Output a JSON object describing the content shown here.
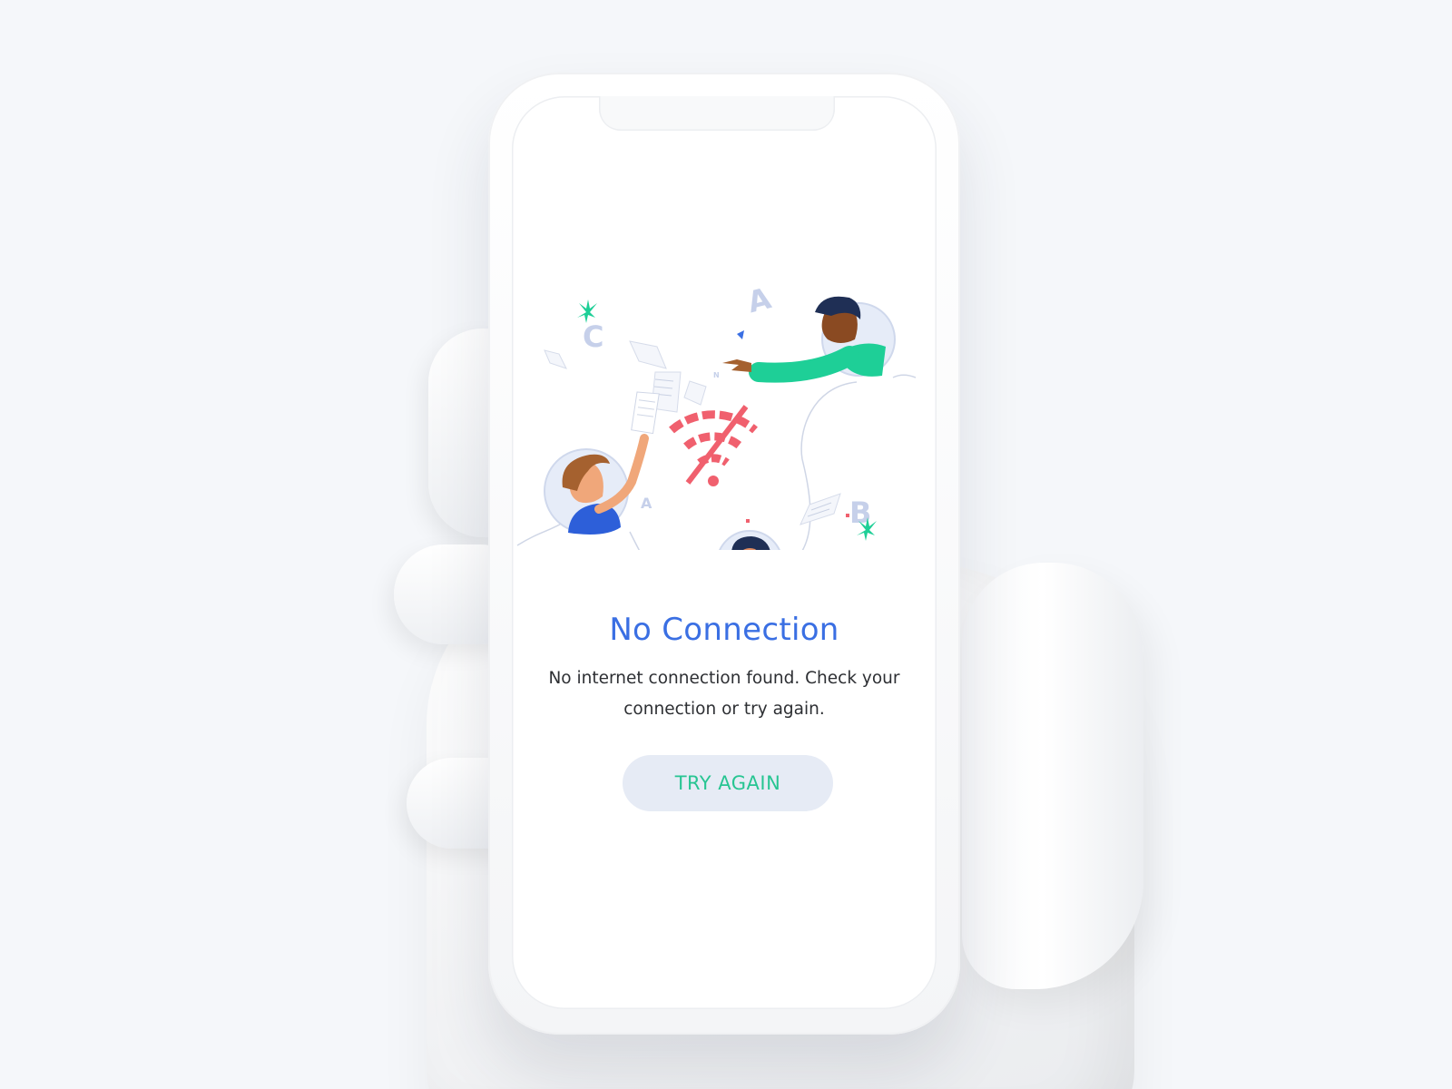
{
  "screen": {
    "title": "No Connection",
    "message": "No internet connection found. Check your connection or try again.",
    "try_again_label": "TRY AGAIN"
  },
  "illustration": {
    "letters": [
      "A",
      "B",
      "C",
      "A"
    ],
    "icons": [
      "wifi-off-icon",
      "leaf-icon",
      "paper-icon"
    ]
  },
  "colors": {
    "title": "#3a6fe3",
    "button_text": "#27c592",
    "button_bg": "#e6ebf5",
    "wifi_off": "#f0606e",
    "accent_green": "#1ecf97"
  }
}
